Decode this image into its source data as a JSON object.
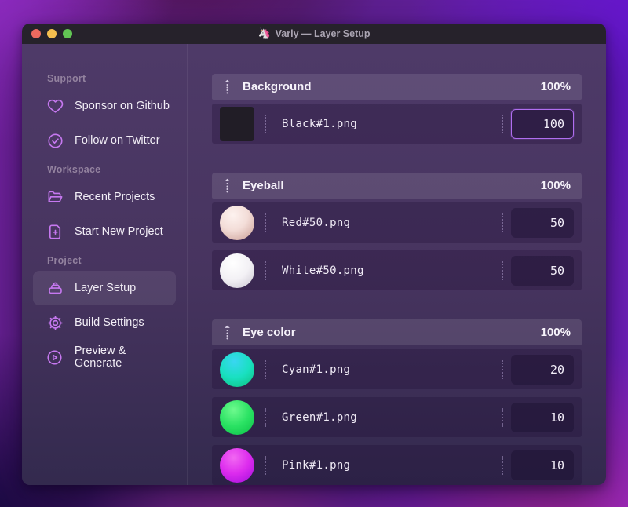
{
  "window": {
    "app_icon": "🦄",
    "title": "Varly — Layer Setup"
  },
  "traffic_lights": {
    "close": "close-button",
    "minimize": "minimize-button",
    "zoom": "zoom-button"
  },
  "sidebar": {
    "sections": [
      {
        "label": "Support",
        "items": [
          {
            "icon": "heart-icon",
            "label": "Sponsor on Github",
            "active": false
          },
          {
            "icon": "badge-check-icon",
            "label": "Follow on Twitter",
            "active": false
          }
        ]
      },
      {
        "label": "Workspace",
        "items": [
          {
            "icon": "folder-open-icon",
            "label": "Recent Projects",
            "active": false
          },
          {
            "icon": "document-plus-icon",
            "label": "Start New Project",
            "active": false
          }
        ]
      },
      {
        "label": "Project",
        "items": [
          {
            "icon": "layers-icon",
            "label": "Layer Setup",
            "active": true
          },
          {
            "icon": "gear-icon",
            "label": "Build Settings",
            "active": false
          },
          {
            "icon": "play-circle-icon",
            "label": "Preview & Generate",
            "active": false
          }
        ]
      }
    ]
  },
  "layer_groups": [
    {
      "name": "Background",
      "weight": "100%",
      "layers": [
        {
          "file": "Black#1.png",
          "value": "100",
          "thumb": "black-square",
          "shape": "square",
          "focused": true
        }
      ]
    },
    {
      "name": "Eyeball",
      "weight": "100%",
      "layers": [
        {
          "file": "Red#50.png",
          "value": "50",
          "thumb": "red-sphere",
          "shape": "sphere",
          "focused": false
        },
        {
          "file": "White#50.png",
          "value": "50",
          "thumb": "white-sphere",
          "shape": "sphere",
          "focused": false
        }
      ]
    },
    {
      "name": "Eye color",
      "weight": "100%",
      "layers": [
        {
          "file": "Cyan#1.png",
          "value": "20",
          "thumb": "cyan-sphere",
          "shape": "sphere",
          "focused": false
        },
        {
          "file": "Green#1.png",
          "value": "10",
          "thumb": "green-sphere",
          "shape": "sphere",
          "focused": false
        },
        {
          "file": "Pink#1.png",
          "value": "10",
          "thumb": "pink-sphere",
          "shape": "sphere",
          "focused": false
        }
      ]
    }
  ],
  "colors": {
    "accent": "#b06ef0",
    "icon": "#c678f0",
    "titlebar": "#26222b",
    "window_top": "#4e3a68",
    "window_bottom": "#332a4e",
    "traffic_red": "#ee6a5f",
    "traffic_yellow": "#f5bf4f",
    "traffic_green": "#62c554"
  }
}
